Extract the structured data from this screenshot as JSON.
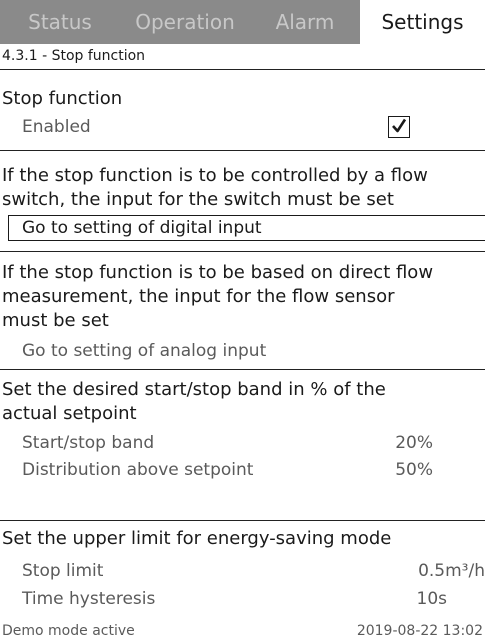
{
  "tabs": [
    {
      "label": "Status"
    },
    {
      "label": "Operation"
    },
    {
      "label": "Alarm"
    },
    {
      "label": "Settings",
      "active": true
    }
  ],
  "breadcrumb": "4.3.1 - Stop function",
  "stop_function": {
    "heading": "Stop function",
    "enabled_label": "Enabled",
    "enabled_checked": true
  },
  "flow_switch": {
    "line1": "If the stop function is to be controlled by a flow",
    "line2": "switch, the input for the switch must be set",
    "link": "Go to setting of digital input"
  },
  "flow_measurement": {
    "line1": "If the stop function is to be based on direct flow",
    "line2": "measurement, the input for the flow sensor",
    "line3": "must be set",
    "link": "Go to setting of analog input"
  },
  "band": {
    "line1": "Set the desired start/stop band in % of the",
    "line2": "actual setpoint",
    "start_stop_label": "Start/stop band",
    "start_stop_value": "20%",
    "distribution_label": "Distribution above setpoint",
    "distribution_value": "50%"
  },
  "energy": {
    "heading": "Set the upper limit for energy-saving mode",
    "stop_limit_label": "Stop limit",
    "stop_limit_value": "0.5m³/h",
    "hysteresis_label": "Time hysteresis",
    "hysteresis_value": "10s"
  },
  "status_bar": {
    "left": "Demo mode active",
    "right": "2019-08-22  13:02"
  },
  "colors": {
    "tab_bar": "#8a8a8a",
    "inactive_tab_text": "#c8c8c8",
    "text": "#1a1a1a",
    "muted_text": "#5a5a5a"
  }
}
